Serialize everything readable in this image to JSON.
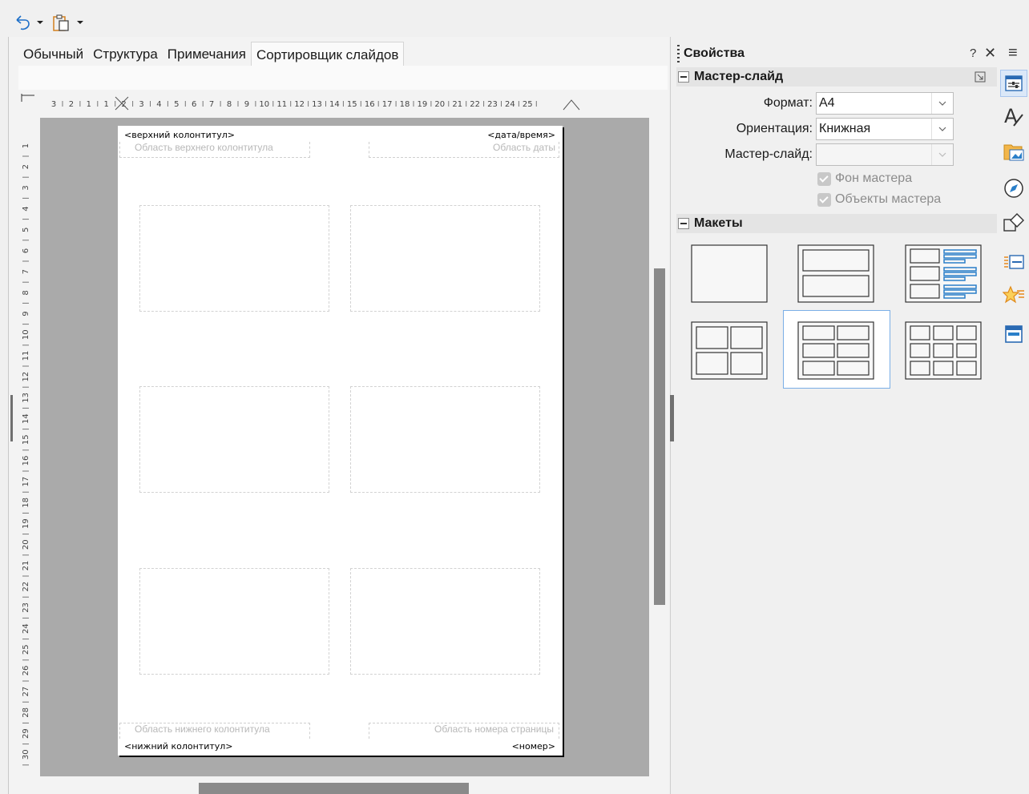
{
  "toolbar": {
    "undo_icon": "undo-icon",
    "paste_icon": "paste-icon"
  },
  "view_tabs": [
    {
      "label": "Обычный"
    },
    {
      "label": "Структура"
    },
    {
      "label": "Примечания"
    },
    {
      "label": "Сортировщик слайдов",
      "active": true
    }
  ],
  "ruler": {
    "h_labels": [
      "3",
      "2",
      "1",
      "1",
      "2",
      "3",
      "4",
      "5",
      "6",
      "7",
      "8",
      "9",
      "10",
      "11",
      "12",
      "13",
      "14",
      "15",
      "16",
      "17",
      "18",
      "19",
      "20",
      "21",
      "22",
      "23",
      "24",
      "25"
    ],
    "v_labels": [
      "1",
      "2",
      "3",
      "4",
      "5",
      "6",
      "7",
      "8",
      "9",
      "10",
      "11",
      "12",
      "13",
      "14",
      "15",
      "16",
      "17",
      "18",
      "19",
      "20",
      "21",
      "22",
      "23",
      "24",
      "25",
      "26",
      "27",
      "28",
      "29",
      "30"
    ]
  },
  "page": {
    "header_label": "<верхний колонтитул>",
    "header_area": "Область верхнего колонтитула",
    "date_label": "<дата/время>",
    "date_area": "Область даты",
    "footer_area": "Область нижнего колонтитула",
    "footer_label": "<нижний колонтитул>",
    "number_area": "Область номера страницы",
    "number_label": "<номер>"
  },
  "sidebar": {
    "title": "Свойства",
    "help": "?",
    "close": "✕",
    "menu": "≡",
    "master_section": {
      "title": "Мастер-слайд",
      "format_label": "Формат:",
      "format_value": "A4",
      "orientation_label": "Ориентация:",
      "orientation_value": "Книжная",
      "master_label": "Мастер-слайд:",
      "master_value": "",
      "bg_checkbox": "Фон мастера",
      "objects_checkbox": "Объекты мастера"
    },
    "layouts_section": {
      "title": "Макеты",
      "selected_index": 4
    },
    "deck_icons": [
      "properties-icon",
      "styles-icon",
      "gallery-icon",
      "navigator-icon",
      "shapes-icon",
      "slide-transition-icon",
      "animation-icon",
      "master-slides-icon"
    ]
  }
}
